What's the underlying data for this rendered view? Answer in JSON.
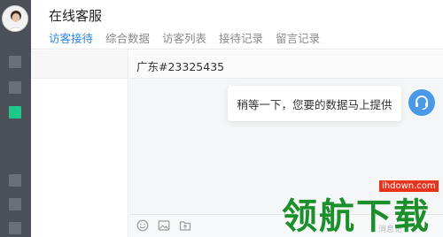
{
  "app": {
    "title": "在线客服"
  },
  "tabs": [
    {
      "label": "访客接待",
      "active": true
    },
    {
      "label": "综合数据",
      "active": false
    },
    {
      "label": "访客列表",
      "active": false
    },
    {
      "label": "接待记录",
      "active": false
    },
    {
      "label": "留言记录",
      "active": false
    }
  ],
  "sidebar": {
    "items": [
      {
        "name": "nav-item-1",
        "active": false
      },
      {
        "name": "nav-item-2",
        "active": false
      },
      {
        "name": "nav-item-3",
        "active": true
      },
      {
        "name": "nav-item-4",
        "active": false
      },
      {
        "name": "nav-item-5",
        "active": false
      },
      {
        "name": "nav-item-6",
        "active": false
      }
    ]
  },
  "chat": {
    "visitor_name": "广东#23325435",
    "message": "稍等一下，您要的数据马上提供",
    "hint": "消息记"
  },
  "toolbar": {
    "icons": [
      "emoji-icon",
      "image-icon",
      "file-icon"
    ]
  },
  "watermark": {
    "text": "领航下载",
    "domain": "ihdown.com"
  },
  "colors": {
    "accent": "#2e86e0",
    "rail": "#4b4f56",
    "active_nav": "#1ec78b",
    "watermark": "#1a8f2a"
  }
}
